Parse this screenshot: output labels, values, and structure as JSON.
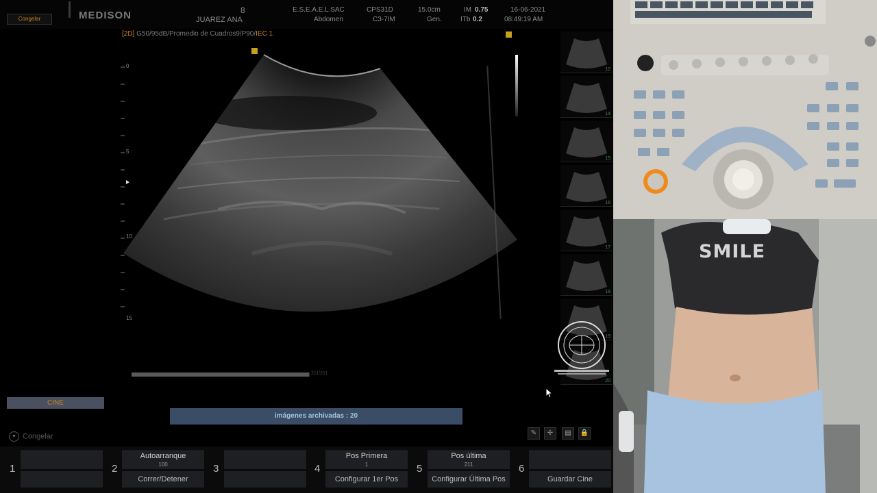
{
  "header": {
    "freeze_tag": "Congelar",
    "logo": "MEDISON",
    "patient_id": "8",
    "patient_name": "JUAREZ ANA",
    "institution": "E.S.E.A.E.L SAC",
    "exam": "Abdomen",
    "probe_model": "CPS31D",
    "transducer": "C3-7IM",
    "depth": "15.0cm",
    "freq_mode": "Gen.",
    "mi_label": "IM",
    "mi_value": "0.75",
    "tib_label": "ITb",
    "tib_value": "0.2",
    "date": "16-06-2021",
    "time": "08:49:19 AM"
  },
  "image_params": {
    "mode": "[2D]",
    "params": "G50/95dB/Promedio de Cuadros9/P90/",
    "iec": "IEC 1"
  },
  "depth_scale": [
    "0",
    "5",
    "10",
    "15"
  ],
  "thumbnails": [
    "12",
    "14",
    "15",
    "16",
    "17",
    "18",
    "19",
    "20"
  ],
  "cine": {
    "label": "CINE",
    "progress_fraction": 0.995,
    "progress_text": "211/211"
  },
  "status": {
    "message": "imágenes archivadas : 20"
  },
  "freeze_control": {
    "label": "Congelar"
  },
  "softkeys": [
    {
      "num": "1",
      "top": "",
      "top_sub": "",
      "bottom": ""
    },
    {
      "num": "2",
      "top": "Autoarranque",
      "top_sub": "100",
      "bottom": "Correr/Detener"
    },
    {
      "num": "3",
      "top": "",
      "top_sub": "",
      "bottom": ""
    },
    {
      "num": "4",
      "top": "Pos Primera",
      "top_sub": "1",
      "bottom": "Configurar 1er Pos"
    },
    {
      "num": "5",
      "top": "Pos última",
      "top_sub": "211",
      "bottom": "Configurar Última Pos"
    },
    {
      "num": "6",
      "top": "",
      "top_sub": "",
      "bottom": "Guardar Cine"
    }
  ],
  "patient_camera": {
    "shirt_text": "SMILE"
  },
  "colors": {
    "accent_orange": "#c8841a",
    "status_blue": "#3b4c66",
    "status_text": "#9ec7e0"
  }
}
